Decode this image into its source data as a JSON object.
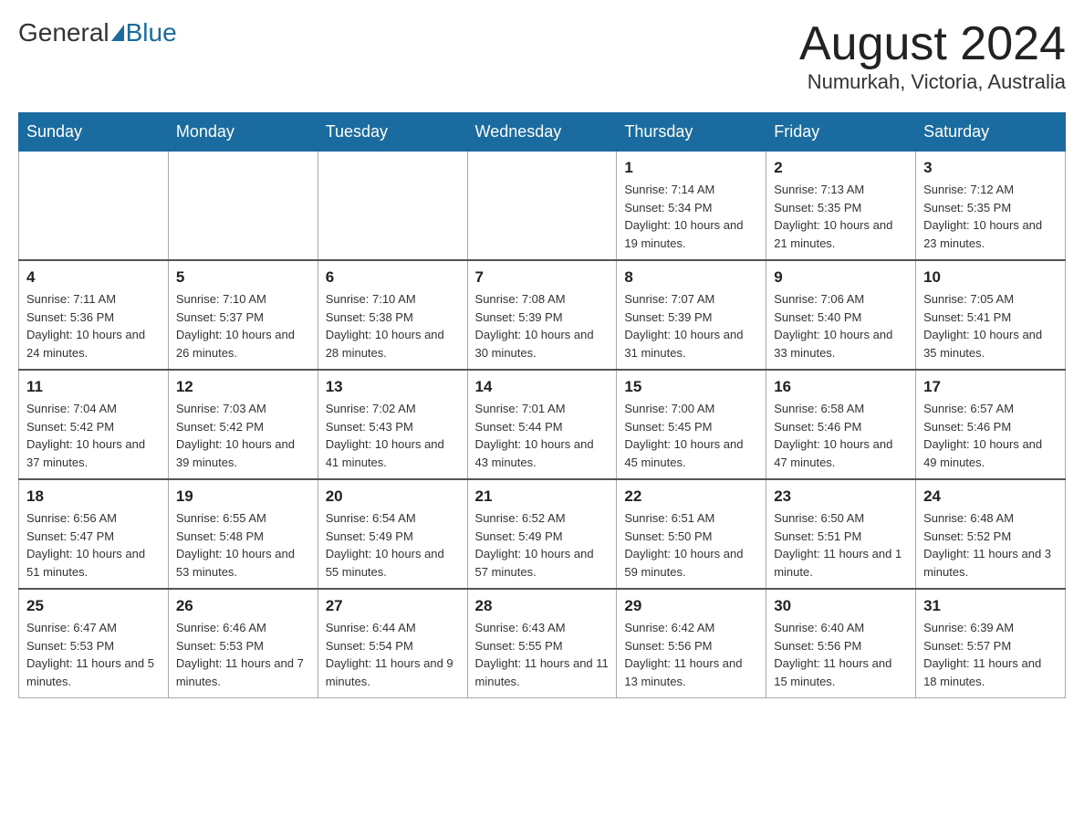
{
  "header": {
    "logo_general": "General",
    "logo_blue": "Blue",
    "month_title": "August 2024",
    "location": "Numurkah, Victoria, Australia"
  },
  "days_of_week": [
    "Sunday",
    "Monday",
    "Tuesday",
    "Wednesday",
    "Thursday",
    "Friday",
    "Saturday"
  ],
  "weeks": [
    [
      {
        "day": "",
        "sunrise": "",
        "sunset": "",
        "daylight": ""
      },
      {
        "day": "",
        "sunrise": "",
        "sunset": "",
        "daylight": ""
      },
      {
        "day": "",
        "sunrise": "",
        "sunset": "",
        "daylight": ""
      },
      {
        "day": "",
        "sunrise": "",
        "sunset": "",
        "daylight": ""
      },
      {
        "day": "1",
        "sunrise": "Sunrise: 7:14 AM",
        "sunset": "Sunset: 5:34 PM",
        "daylight": "Daylight: 10 hours and 19 minutes."
      },
      {
        "day": "2",
        "sunrise": "Sunrise: 7:13 AM",
        "sunset": "Sunset: 5:35 PM",
        "daylight": "Daylight: 10 hours and 21 minutes."
      },
      {
        "day": "3",
        "sunrise": "Sunrise: 7:12 AM",
        "sunset": "Sunset: 5:35 PM",
        "daylight": "Daylight: 10 hours and 23 minutes."
      }
    ],
    [
      {
        "day": "4",
        "sunrise": "Sunrise: 7:11 AM",
        "sunset": "Sunset: 5:36 PM",
        "daylight": "Daylight: 10 hours and 24 minutes."
      },
      {
        "day": "5",
        "sunrise": "Sunrise: 7:10 AM",
        "sunset": "Sunset: 5:37 PM",
        "daylight": "Daylight: 10 hours and 26 minutes."
      },
      {
        "day": "6",
        "sunrise": "Sunrise: 7:10 AM",
        "sunset": "Sunset: 5:38 PM",
        "daylight": "Daylight: 10 hours and 28 minutes."
      },
      {
        "day": "7",
        "sunrise": "Sunrise: 7:08 AM",
        "sunset": "Sunset: 5:39 PM",
        "daylight": "Daylight: 10 hours and 30 minutes."
      },
      {
        "day": "8",
        "sunrise": "Sunrise: 7:07 AM",
        "sunset": "Sunset: 5:39 PM",
        "daylight": "Daylight: 10 hours and 31 minutes."
      },
      {
        "day": "9",
        "sunrise": "Sunrise: 7:06 AM",
        "sunset": "Sunset: 5:40 PM",
        "daylight": "Daylight: 10 hours and 33 minutes."
      },
      {
        "day": "10",
        "sunrise": "Sunrise: 7:05 AM",
        "sunset": "Sunset: 5:41 PM",
        "daylight": "Daylight: 10 hours and 35 minutes."
      }
    ],
    [
      {
        "day": "11",
        "sunrise": "Sunrise: 7:04 AM",
        "sunset": "Sunset: 5:42 PM",
        "daylight": "Daylight: 10 hours and 37 minutes."
      },
      {
        "day": "12",
        "sunrise": "Sunrise: 7:03 AM",
        "sunset": "Sunset: 5:42 PM",
        "daylight": "Daylight: 10 hours and 39 minutes."
      },
      {
        "day": "13",
        "sunrise": "Sunrise: 7:02 AM",
        "sunset": "Sunset: 5:43 PM",
        "daylight": "Daylight: 10 hours and 41 minutes."
      },
      {
        "day": "14",
        "sunrise": "Sunrise: 7:01 AM",
        "sunset": "Sunset: 5:44 PM",
        "daylight": "Daylight: 10 hours and 43 minutes."
      },
      {
        "day": "15",
        "sunrise": "Sunrise: 7:00 AM",
        "sunset": "Sunset: 5:45 PM",
        "daylight": "Daylight: 10 hours and 45 minutes."
      },
      {
        "day": "16",
        "sunrise": "Sunrise: 6:58 AM",
        "sunset": "Sunset: 5:46 PM",
        "daylight": "Daylight: 10 hours and 47 minutes."
      },
      {
        "day": "17",
        "sunrise": "Sunrise: 6:57 AM",
        "sunset": "Sunset: 5:46 PM",
        "daylight": "Daylight: 10 hours and 49 minutes."
      }
    ],
    [
      {
        "day": "18",
        "sunrise": "Sunrise: 6:56 AM",
        "sunset": "Sunset: 5:47 PM",
        "daylight": "Daylight: 10 hours and 51 minutes."
      },
      {
        "day": "19",
        "sunrise": "Sunrise: 6:55 AM",
        "sunset": "Sunset: 5:48 PM",
        "daylight": "Daylight: 10 hours and 53 minutes."
      },
      {
        "day": "20",
        "sunrise": "Sunrise: 6:54 AM",
        "sunset": "Sunset: 5:49 PM",
        "daylight": "Daylight: 10 hours and 55 minutes."
      },
      {
        "day": "21",
        "sunrise": "Sunrise: 6:52 AM",
        "sunset": "Sunset: 5:49 PM",
        "daylight": "Daylight: 10 hours and 57 minutes."
      },
      {
        "day": "22",
        "sunrise": "Sunrise: 6:51 AM",
        "sunset": "Sunset: 5:50 PM",
        "daylight": "Daylight: 10 hours and 59 minutes."
      },
      {
        "day": "23",
        "sunrise": "Sunrise: 6:50 AM",
        "sunset": "Sunset: 5:51 PM",
        "daylight": "Daylight: 11 hours and 1 minute."
      },
      {
        "day": "24",
        "sunrise": "Sunrise: 6:48 AM",
        "sunset": "Sunset: 5:52 PM",
        "daylight": "Daylight: 11 hours and 3 minutes."
      }
    ],
    [
      {
        "day": "25",
        "sunrise": "Sunrise: 6:47 AM",
        "sunset": "Sunset: 5:53 PM",
        "daylight": "Daylight: 11 hours and 5 minutes."
      },
      {
        "day": "26",
        "sunrise": "Sunrise: 6:46 AM",
        "sunset": "Sunset: 5:53 PM",
        "daylight": "Daylight: 11 hours and 7 minutes."
      },
      {
        "day": "27",
        "sunrise": "Sunrise: 6:44 AM",
        "sunset": "Sunset: 5:54 PM",
        "daylight": "Daylight: 11 hours and 9 minutes."
      },
      {
        "day": "28",
        "sunrise": "Sunrise: 6:43 AM",
        "sunset": "Sunset: 5:55 PM",
        "daylight": "Daylight: 11 hours and 11 minutes."
      },
      {
        "day": "29",
        "sunrise": "Sunrise: 6:42 AM",
        "sunset": "Sunset: 5:56 PM",
        "daylight": "Daylight: 11 hours and 13 minutes."
      },
      {
        "day": "30",
        "sunrise": "Sunrise: 6:40 AM",
        "sunset": "Sunset: 5:56 PM",
        "daylight": "Daylight: 11 hours and 15 minutes."
      },
      {
        "day": "31",
        "sunrise": "Sunrise: 6:39 AM",
        "sunset": "Sunset: 5:57 PM",
        "daylight": "Daylight: 11 hours and 18 minutes."
      }
    ]
  ]
}
